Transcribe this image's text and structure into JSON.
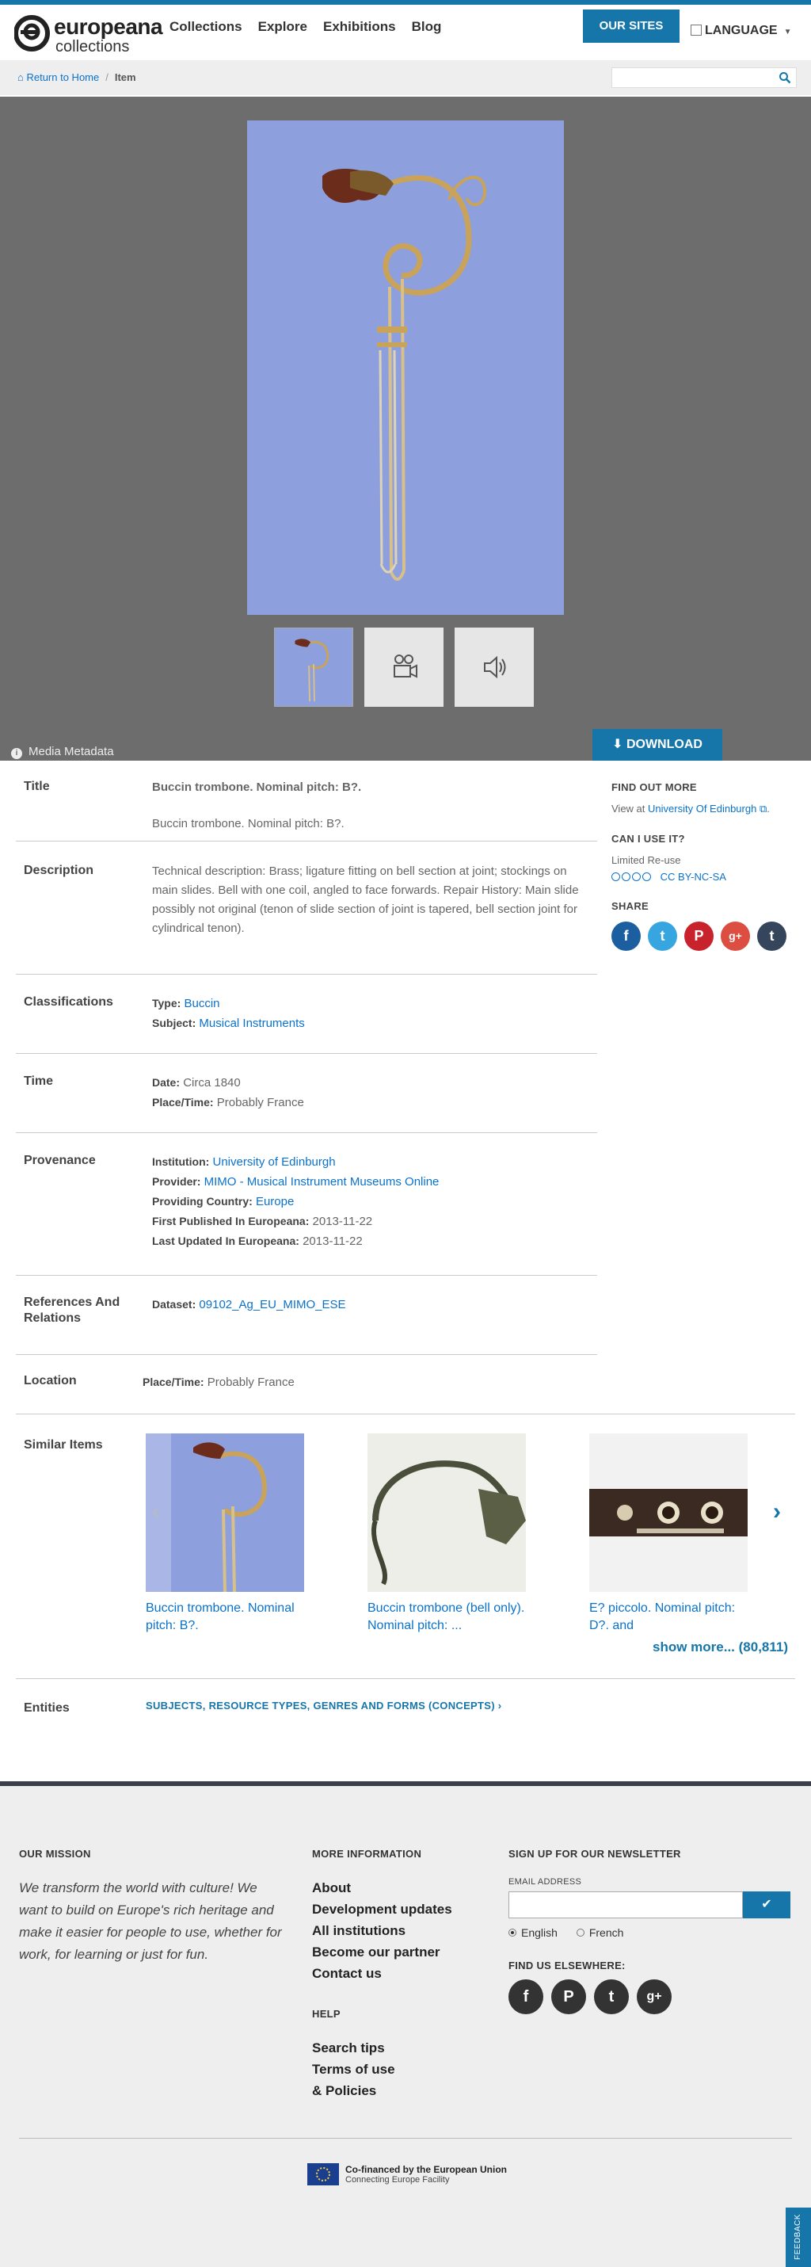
{
  "header": {
    "logo_line1": "europeana",
    "logo_line2": "collections",
    "nav": [
      "Collections",
      "Explore",
      "Exhibitions",
      "Blog"
    ],
    "our_sites": "OUR SITES",
    "language": "LANGUAGE"
  },
  "breadcrumb": {
    "home": "Return to Home",
    "current": "Item"
  },
  "search": {
    "placeholder": ""
  },
  "media": {
    "metadata_label": "Media Metadata",
    "download_label": "DOWNLOAD"
  },
  "title": {
    "label": "Title",
    "main": "Buccin trombone. Nominal pitch: B?.",
    "sub": "Buccin trombone. Nominal pitch: B?."
  },
  "description": {
    "label": "Description",
    "text": "Technical description: Brass; ligature fitting on bell section at joint; stockings on main slides. Bell with one coil, angled to face forwards. Repair History: Main slide possibly not original (tenon of slide section of joint is tapered, bell section joint for cylindrical tenon)."
  },
  "classifications": {
    "label": "Classifications",
    "type_key": "Type:",
    "type_val": "Buccin",
    "subject_key": "Subject:",
    "subject_val": "Musical Instruments"
  },
  "time": {
    "label": "Time",
    "date_key": "Date:",
    "date_val": "Circa 1840",
    "place_key": "Place/Time:",
    "place_val": "Probably France"
  },
  "provenance": {
    "label": "Provenance",
    "institution_key": "Institution:",
    "institution_val": "University of Edinburgh",
    "provider_key": "Provider:",
    "provider_val": "MIMO - Musical Instrument Museums Online",
    "country_key": "Providing Country:",
    "country_val": "Europe",
    "first_key": "First Published In Europeana:",
    "first_val": "2013-11-22",
    "updated_key": "Last Updated In Europeana:",
    "updated_val": "2013-11-22"
  },
  "references": {
    "label": "References And Relations",
    "dataset_key": "Dataset:",
    "dataset_val": "09102_Ag_EU_MIMO_ESE"
  },
  "location": {
    "label": "Location",
    "place_key": "Place/Time:",
    "place_val": "Probably France"
  },
  "sidebar": {
    "find_out_more": "FIND OUT MORE",
    "view_at": "View at",
    "view_link": "University Of Edinburgh",
    "can_i_use": "CAN I USE IT?",
    "limited": "Limited Re-use",
    "license": "CC BY-NC-SA",
    "share": "SHARE",
    "share_icons": [
      "facebook-icon",
      "twitter-icon",
      "pinterest-icon",
      "google-plus-icon",
      "tumblr-icon"
    ]
  },
  "similar": {
    "label": "Similar Items",
    "items": [
      "Buccin trombone. Nominal pitch: B?.",
      "Buccin trombone (bell only). Nominal pitch: ...",
      "E? piccolo. Nominal pitch: D?. and"
    ],
    "show_more": "show more... (80,811)"
  },
  "entities": {
    "label": "Entities",
    "link": "SUBJECTS, RESOURCE TYPES, GENRES AND FORMS (CONCEPTS)"
  },
  "footer": {
    "mission_title": "OUR MISSION",
    "mission_text": "We transform the world with culture! We want to build on Europe's rich heritage and make it easier for people to use, whether for work, for learning or just for fun.",
    "more_title": "MORE INFORMATION",
    "more_links": [
      "About",
      "Development updates",
      "All institutions",
      "Become our partner",
      "Contact us"
    ],
    "help_title": "HELP",
    "help_links": [
      "Search tips",
      "Terms of use",
      "& Policies"
    ],
    "newsletter_title": "SIGN UP FOR OUR NEWSLETTER",
    "email_label": "EMAIL ADDRESS",
    "lang_english": "English",
    "lang_french": "French",
    "find_us": "FIND US ELSEWHERE:",
    "eu_line1": "Co-financed by the European Union",
    "eu_line2": "Connecting Europe Facility",
    "feedback": "FEEDBACK"
  },
  "colors": {
    "accent": "#1676aa",
    "media_bg": "#6d6d6d",
    "image_bg": "#8d9fdd"
  }
}
